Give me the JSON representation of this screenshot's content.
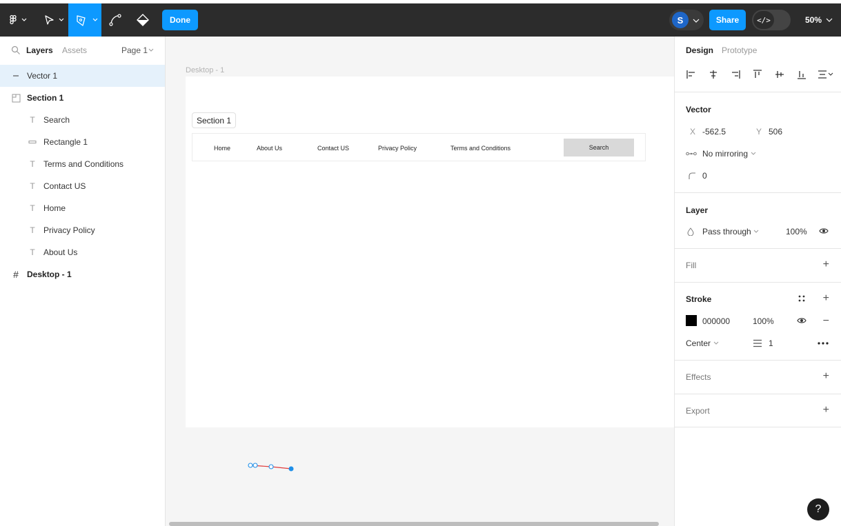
{
  "toolbar": {
    "done_label": "Done",
    "share_label": "Share",
    "avatar_initial": "S",
    "code_label": "</>",
    "zoom_label": "50%"
  },
  "left_panel": {
    "tabs": {
      "layers": "Layers",
      "assets": "Assets",
      "page": "Page 1"
    },
    "layers": [
      {
        "label": "Vector 1",
        "icon": "vector-icon",
        "depth": 0,
        "selected": true
      },
      {
        "label": "Section 1",
        "icon": "section-icon",
        "depth": 0,
        "selected": false
      },
      {
        "label": "Search",
        "icon": "text-icon",
        "depth": 1,
        "selected": false
      },
      {
        "label": "Rectangle 1",
        "icon": "rectangle-icon",
        "depth": 1,
        "selected": false
      },
      {
        "label": "Terms and Conditions",
        "icon": "text-icon",
        "depth": 1,
        "selected": false
      },
      {
        "label": "Contact US",
        "icon": "text-icon",
        "depth": 1,
        "selected": false
      },
      {
        "label": "Home",
        "icon": "text-icon",
        "depth": 1,
        "selected": false
      },
      {
        "label": "Privacy Policy",
        "icon": "text-icon",
        "depth": 1,
        "selected": false
      },
      {
        "label": "About Us",
        "icon": "text-icon",
        "depth": 1,
        "selected": false
      },
      {
        "label": "Desktop - 1",
        "icon": "frame-icon",
        "depth": 0,
        "selected": false
      }
    ]
  },
  "canvas": {
    "frame_label": "Desktop - 1",
    "section_label": "Section 1",
    "nav": {
      "home": "Home",
      "about": "About Us",
      "contact": "Contact US",
      "privacy": "Privacy Policy",
      "terms": "Terms and Conditions",
      "search": "Search"
    }
  },
  "right_panel": {
    "tabs": {
      "design": "Design",
      "prototype": "Prototype"
    },
    "vector": {
      "title": "Vector",
      "x_label": "X",
      "x_value": "-562.5",
      "y_label": "Y",
      "y_value": "506",
      "mirroring": "No mirroring",
      "corner_radius": "0"
    },
    "layer": {
      "title": "Layer",
      "blend": "Pass through",
      "opacity": "100%"
    },
    "fill": {
      "title": "Fill"
    },
    "stroke": {
      "title": "Stroke",
      "color_hex": "000000",
      "opacity": "100%",
      "position": "Center",
      "weight": "1"
    },
    "effects": {
      "title": "Effects"
    },
    "export": {
      "title": "Export"
    }
  },
  "help_label": "?",
  "colors": {
    "accent": "#0d99ff",
    "toolbar_bg": "#2c2c2c",
    "selected_row": "#e5f1fb",
    "vector_stroke": "#e03a3a"
  }
}
